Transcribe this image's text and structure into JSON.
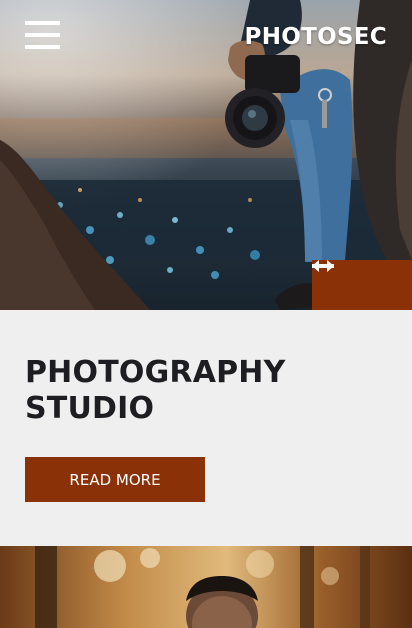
{
  "header": {
    "menu_icon": "hamburger-menu-icon",
    "brand": "PHOTOSEC"
  },
  "slider": {
    "prev_icon": "arrow-left-icon",
    "next_icon": "arrow-right-icon"
  },
  "hero_section": {
    "title": "PHOTOGRAPHY STUDIO",
    "button_label": "READ MORE"
  },
  "colors": {
    "accent": "#8a3108",
    "text_dark": "#1e1e22",
    "background": "#efefef",
    "white": "#ffffff"
  }
}
